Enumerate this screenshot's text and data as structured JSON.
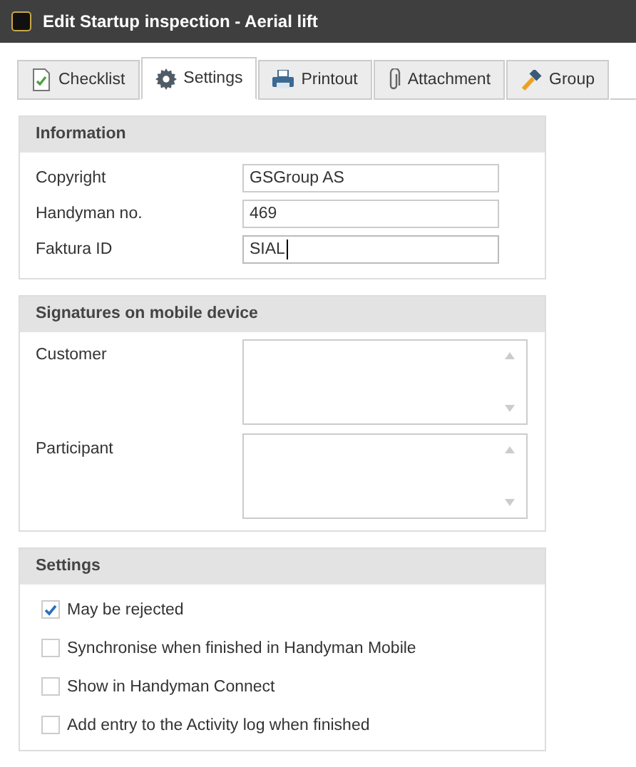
{
  "window": {
    "title": "Edit Startup inspection - Aerial lift"
  },
  "tabs": [
    {
      "label": "Checklist",
      "kind": "checklist",
      "selected": false
    },
    {
      "label": "Settings",
      "kind": "gear",
      "selected": true
    },
    {
      "label": "Printout",
      "kind": "printer",
      "selected": false
    },
    {
      "label": "Attachment",
      "kind": "paperclip",
      "selected": false
    },
    {
      "label": "Group",
      "kind": "hammer",
      "selected": false
    }
  ],
  "information": {
    "title": "Information",
    "fields": [
      {
        "label": "Copyright",
        "value": "GSGroup AS",
        "focused": false
      },
      {
        "label": "Handyman no.",
        "value": "469",
        "focused": false
      },
      {
        "label": "Faktura ID",
        "value": "SIAL",
        "focused": true
      }
    ]
  },
  "signatures": {
    "title": "Signatures on mobile device",
    "fields": [
      {
        "label": "Customer"
      },
      {
        "label": "Participant"
      }
    ]
  },
  "settings": {
    "title": "Settings",
    "options": [
      {
        "label": "May be rejected",
        "checked": true
      },
      {
        "label": "Synchronise when finished in Handyman Mobile",
        "checked": false
      },
      {
        "label": "Show in Handyman Connect",
        "checked": false
      },
      {
        "label": "Add entry to the Activity log when finished",
        "checked": false
      }
    ]
  }
}
